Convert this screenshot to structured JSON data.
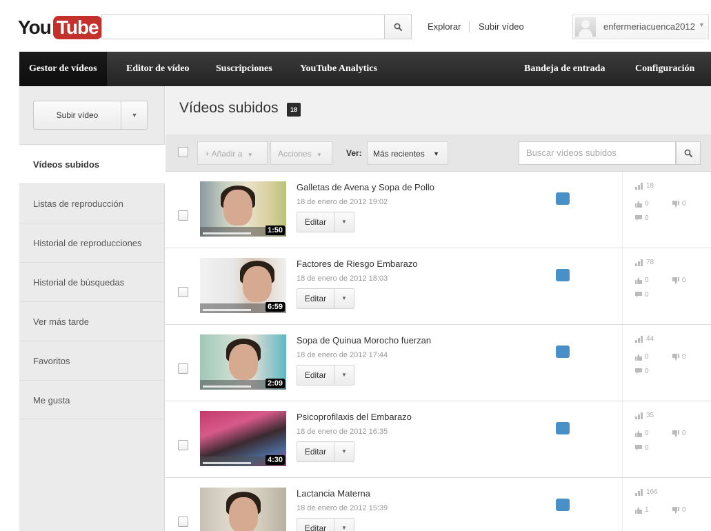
{
  "masthead": {
    "logo_you": "You",
    "logo_tube": "Tube",
    "search_placeholder": "",
    "links": [
      "Explorar",
      "Subir vídeo"
    ],
    "username": "enfermeriacuenca2012"
  },
  "nav": {
    "items": [
      "Gestor de vídeos",
      "Editor de vídeo",
      "Suscripciones",
      "YouTube Analytics"
    ],
    "right_items": [
      "Bandeja de entrada",
      "Configuración"
    ]
  },
  "sidebar": {
    "upload_label": "Subir vídeo",
    "items": [
      "Vídeos subidos",
      "Listas de reproducción",
      "Historial de reproducciones",
      "Historial de búsquedas",
      "Ver más tarde",
      "Favoritos",
      "Me gusta"
    ]
  },
  "main": {
    "title": "Vídeos subidos",
    "count": "18",
    "toolbar": {
      "add_to": "+ Añadir a",
      "actions": "Acciones",
      "view_label": "Ver:",
      "sort": "Más recientes",
      "search_placeholder": "Buscar vídeos subidos"
    },
    "edit_label": "Editar",
    "videos": [
      {
        "title": "Galletas de Avena y Sopa de Pollo",
        "date": "18 de enero de 2012 19:02",
        "duration": "1:50",
        "views": "18",
        "likes": "0",
        "dislikes": "0",
        "comments": "0"
      },
      {
        "title": "Factores de Riesgo Embarazo",
        "date": "18 de enero de 2012 18:03",
        "duration": "6:59",
        "views": "78",
        "likes": "0",
        "dislikes": "0",
        "comments": "0"
      },
      {
        "title": "Sopa de Quinua Morocho fuerzan",
        "date": "18 de enero de 2012 17:44",
        "duration": "2:09",
        "views": "44",
        "likes": "0",
        "dislikes": "0",
        "comments": "0"
      },
      {
        "title": "Psicoprofilaxis del Embarazo",
        "date": "18 de enero de 2012 16:35",
        "duration": "4:30",
        "views": "35",
        "likes": "0",
        "dislikes": "0",
        "comments": "0"
      },
      {
        "title": "Lactancia Materna",
        "date": "18 de enero de 2012 15:39",
        "duration": "",
        "views": "166",
        "likes": "1",
        "dislikes": "0",
        "comments": ""
      }
    ]
  },
  "colors": {
    "brand_red": "#c4302b",
    "nav_dark": "#2b2b2b",
    "privacy_blue": "#4a90c8"
  }
}
